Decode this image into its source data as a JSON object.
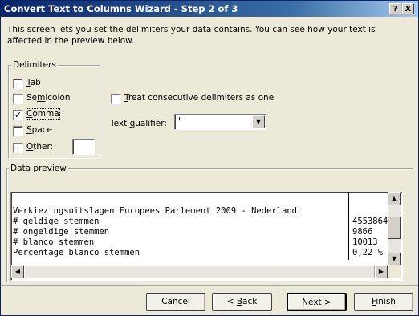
{
  "window": {
    "title": "Convert Text to Columns Wizard - Step 2 of 3",
    "help_label": "?",
    "close_label": "X"
  },
  "intro": "This screen lets you set the delimiters your data contains.  You can see how your text is affected in the preview below.",
  "delimiters": {
    "group_label": "Delimiters",
    "tab": {
      "pre": "",
      "key": "T",
      "post": "ab",
      "checked": false
    },
    "semicolon": {
      "pre": "Se",
      "key": "m",
      "post": "icolon",
      "checked": false
    },
    "comma": {
      "pre": "",
      "key": "C",
      "post": "omma",
      "checked": true
    },
    "space": {
      "pre": "",
      "key": "S",
      "post": "pace",
      "checked": false
    },
    "other": {
      "pre": "",
      "key": "O",
      "post": "ther:",
      "checked": false,
      "value": ""
    }
  },
  "consecutive": {
    "pre": "",
    "key": "T",
    "post": "reat consecutive delimiters as one",
    "checked": false
  },
  "qualifier": {
    "pre": "Text ",
    "key": "q",
    "post": "ualifier:",
    "value": "\""
  },
  "preview": {
    "group_pre": "Data ",
    "group_key": "p",
    "group_post": "review",
    "rows": [
      {
        "col1": "Verkiezingsuitslagen Europees Parlement 2009 - Nederland",
        "col2": ""
      },
      {
        "col1": "# geldige stemmen",
        "col2": "4553864"
      },
      {
        "col1": "# ongeldige stemmen",
        "col2": "9866"
      },
      {
        "col1": "# blanco stemmen",
        "col2": "10013"
      },
      {
        "col1": "Percentage blanco stemmen",
        "col2": "0,22 %"
      }
    ]
  },
  "buttons": {
    "cancel": "Cancel",
    "back": {
      "pre": "< ",
      "key": "B",
      "post": "ack"
    },
    "next": {
      "pre": "",
      "key": "N",
      "post": "ext >"
    },
    "finish": {
      "pre": "",
      "key": "F",
      "post": "inish"
    }
  },
  "check_mark": "✓",
  "colors": {
    "title_start": "#0a246a",
    "title_end": "#a6caf0",
    "face": "#ece9d8"
  }
}
